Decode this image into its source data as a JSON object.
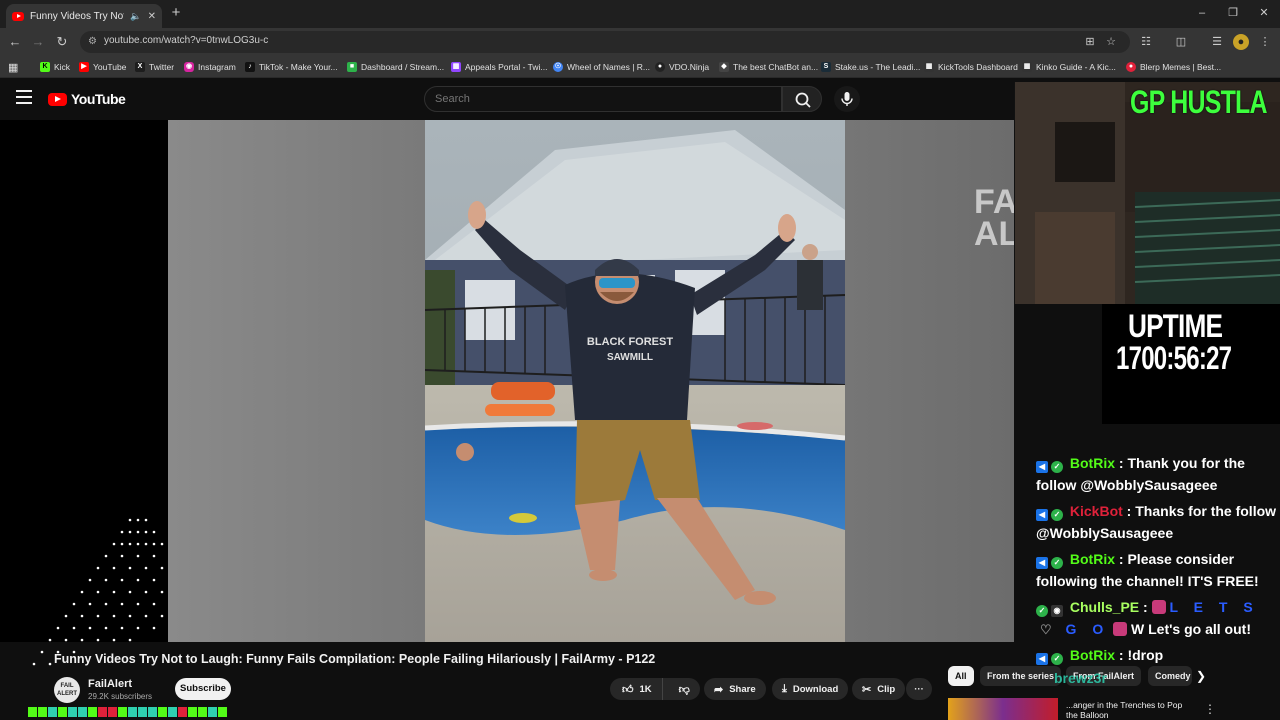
{
  "browser": {
    "tab_title": "Funny Videos Try Not to La",
    "url": "youtube.com/watch?v=0tnwLOG3u-c",
    "bookmarks": [
      {
        "label": "Kick",
        "color": "#53fc18"
      },
      {
        "label": "YouTube",
        "color": "#ff0000"
      },
      {
        "label": "Twitter",
        "color": "#1d1d1d"
      },
      {
        "label": "Instagram",
        "color": "#d6249f"
      },
      {
        "label": "TikTok - Make Your...",
        "color": "#111111"
      },
      {
        "label": "Dashboard / Stream...",
        "color": "#2db24a"
      },
      {
        "label": "Appeals Portal - Twi...",
        "color": "#9146ff"
      },
      {
        "label": "Wheel of Names | R...",
        "color": "#4285f4"
      },
      {
        "label": "VDO.Ninja",
        "color": "#222222"
      },
      {
        "label": "The best ChatBot an...",
        "color": "#444444"
      },
      {
        "label": "Stake.us - The Leadi...",
        "color": "#1a2c38"
      },
      {
        "label": "KickTools Dashboard",
        "color": "#333333"
      },
      {
        "label": "Kinko Guide - A Kic...",
        "color": "#333333"
      },
      {
        "label": "Blerp Memes | Best...",
        "color": "#e0213a"
      }
    ]
  },
  "youtube": {
    "logo_text": "YouTube",
    "search_placeholder": "Search",
    "video_title": "Funny Videos Try Not to Laugh: Funny Fails Compilation: People Failing Hilariously | FailArmy - P122",
    "channel_name": "FailAlert",
    "channel_avatar_text": "FAIL ALERT",
    "subscriber_count": "29.2K subscribers",
    "subscribe_label": "Subscribe",
    "like_count": "1K",
    "share_label": "Share",
    "download_label": "Download",
    "clip_label": "Clip",
    "more_label": "···",
    "watermark": "FA AL",
    "chips": [
      "All",
      "From the series",
      "From FailAlert",
      "Comedy"
    ],
    "suggestion_text": "...anger in the Trenches to Pop the Balloon"
  },
  "stream_overlay": {
    "banner": "GP HUSTLA",
    "uptime_label": "UPTIME",
    "uptime_value": "1700:56:27",
    "viewer_tag": "brewz3r"
  },
  "chat": [
    {
      "user": "BotRix",
      "text": "Thank you for the follow @WobblySausageee",
      "user_color": "green"
    },
    {
      "user": "KickBot",
      "text": "Thanks for the follow @WobblySausageee",
      "user_color": "red"
    },
    {
      "user": "BotRix",
      "text": "Please consider following the channel! IT'S FREE!",
      "user_color": "green"
    },
    {
      "user": "Chulls_PE",
      "text": "L E T S",
      "text2": "G O",
      "text3": "W Let's go all out!",
      "user_color": "lime"
    },
    {
      "user": "BotRix",
      "text": "!drop",
      "user_color": "green"
    }
  ],
  "colors": {
    "accent_red": "#ff0000",
    "kick_green": "#53fc18",
    "overlay_green": "#3dff3d"
  }
}
